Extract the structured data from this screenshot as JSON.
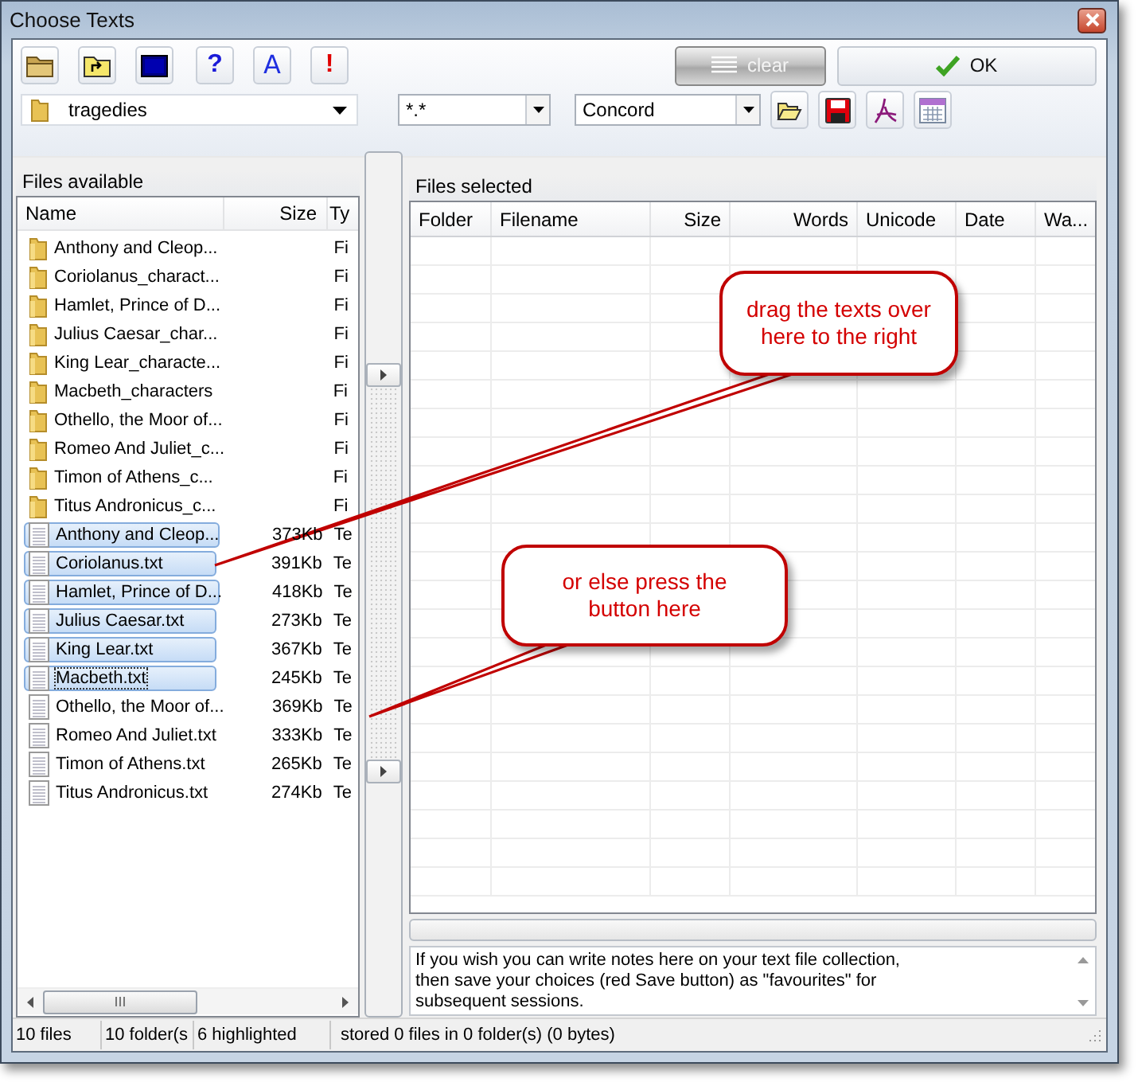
{
  "window": {
    "title": "Choose Texts"
  },
  "toolbar": {
    "buttons": [
      {
        "kind": "open-folder"
      },
      {
        "kind": "folder-up"
      },
      {
        "kind": "screen"
      },
      {
        "kind": "help",
        "glyph": "?"
      },
      {
        "kind": "font",
        "glyph": "A"
      },
      {
        "kind": "alert",
        "glyph": "!"
      }
    ],
    "clear_button": {
      "label": "clear",
      "disabled": true
    },
    "ok_button": {
      "label": "OK"
    },
    "folder_dropdown": {
      "value": "tragedies"
    },
    "filter_combo": {
      "value": "*.*"
    },
    "mode_combo": {
      "value": "Concord"
    },
    "tool_buttons": [
      {
        "kind": "open"
      },
      {
        "kind": "save"
      },
      {
        "kind": "pdf"
      },
      {
        "kind": "calendar"
      }
    ]
  },
  "files_available": {
    "title": "Files available",
    "columns": [
      "Name",
      "Size",
      "Ty"
    ],
    "rows": [
      {
        "kind": "folder",
        "name": "Anthony and Cleop...",
        "size": "",
        "type": "Fi",
        "selected": false,
        "focused": false
      },
      {
        "kind": "folder",
        "name": "Coriolanus_charact...",
        "size": "",
        "type": "Fi",
        "selected": false,
        "focused": false
      },
      {
        "kind": "folder",
        "name": "Hamlet, Prince of D...",
        "size": "",
        "type": "Fi",
        "selected": false,
        "focused": false
      },
      {
        "kind": "folder",
        "name": "Julius Caesar_char...",
        "size": "",
        "type": "Fi",
        "selected": false,
        "focused": false
      },
      {
        "kind": "folder",
        "name": "King Lear_characte...",
        "size": "",
        "type": "Fi",
        "selected": false,
        "focused": false
      },
      {
        "kind": "folder",
        "name": "Macbeth_characters",
        "size": "",
        "type": "Fi",
        "selected": false,
        "focused": false
      },
      {
        "kind": "folder",
        "name": "Othello, the Moor of...",
        "size": "",
        "type": "Fi",
        "selected": false,
        "focused": false
      },
      {
        "kind": "folder",
        "name": "Romeo And Juliet_c...",
        "size": "",
        "type": "Fi",
        "selected": false,
        "focused": false
      },
      {
        "kind": "folder",
        "name": "Timon of Athens_c...",
        "size": "",
        "type": "Fi",
        "selected": false,
        "focused": false
      },
      {
        "kind": "folder",
        "name": "Titus Andronicus_c...",
        "size": "",
        "type": "Fi",
        "selected": false,
        "focused": false
      },
      {
        "kind": "file",
        "name": "Anthony and Cleop...",
        "size": "373Kb",
        "type": "Te",
        "selected": true,
        "focused": false
      },
      {
        "kind": "file",
        "name": "Coriolanus.txt",
        "size": "391Kb",
        "type": "Te",
        "selected": true,
        "focused": false
      },
      {
        "kind": "file",
        "name": "Hamlet, Prince of D...",
        "size": "418Kb",
        "type": "Te",
        "selected": true,
        "focused": false
      },
      {
        "kind": "file",
        "name": "Julius Caesar.txt",
        "size": "273Kb",
        "type": "Te",
        "selected": true,
        "focused": false
      },
      {
        "kind": "file",
        "name": "King Lear.txt",
        "size": "367Kb",
        "type": "Te",
        "selected": true,
        "focused": false
      },
      {
        "kind": "file",
        "name": "Macbeth.txt",
        "size": "245Kb",
        "type": "Te",
        "selected": true,
        "focused": true
      },
      {
        "kind": "file",
        "name": "Othello, the Moor of...",
        "size": "369Kb",
        "type": "Te",
        "selected": false,
        "focused": false
      },
      {
        "kind": "file",
        "name": "Romeo And Juliet.txt",
        "size": "333Kb",
        "type": "Te",
        "selected": false,
        "focused": false
      },
      {
        "kind": "file",
        "name": "Timon of Athens.txt",
        "size": "265Kb",
        "type": "Te",
        "selected": false,
        "focused": false
      },
      {
        "kind": "file",
        "name": "Titus Andronicus.txt",
        "size": "274Kb",
        "type": "Te",
        "selected": false,
        "focused": false
      }
    ]
  },
  "files_selected": {
    "title": "Files selected",
    "columns": [
      "Folder",
      "Filename",
      "Size",
      "Words",
      "Unicode",
      "Date",
      "Wa..."
    ]
  },
  "progress": {
    "level": 0
  },
  "notes": {
    "value": "If you wish you can write notes here on your text file collection,\nthen save your choices (red Save button) as \"favourites\" for\nsubsequent sessions."
  },
  "status_bar": [
    "10 files",
    "10 folder(s",
    "6 highlighted",
    "stored 0 files in 0 folder(s) (0 bytes)"
  ],
  "callouts": [
    {
      "text": "drag the texts over here to the right"
    },
    {
      "text": "or else press the button here"
    }
  ]
}
